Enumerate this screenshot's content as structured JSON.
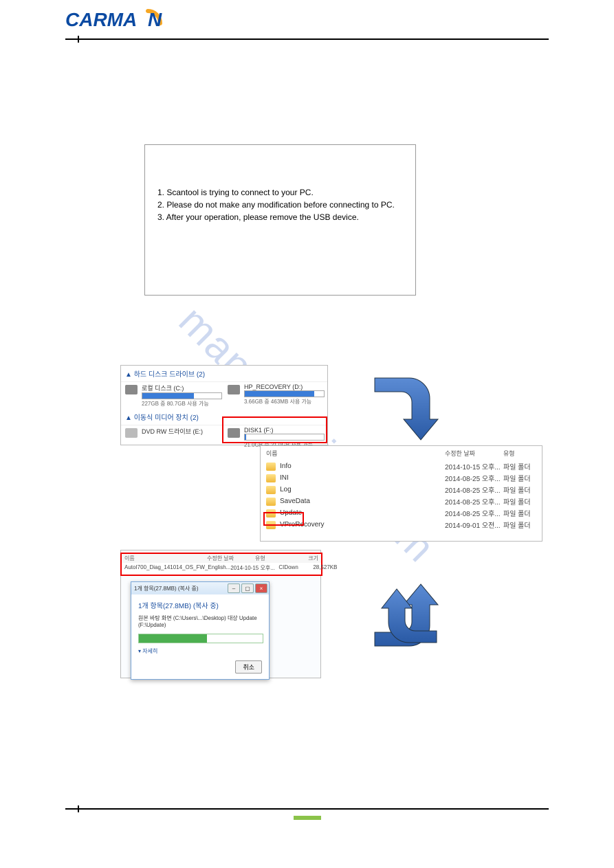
{
  "brand": {
    "name": "CARMAN"
  },
  "dialog1": {
    "line1": "1. Scantool is trying to connect to your PC.",
    "line2": "2. Please do not make any modification before connecting to PC.",
    "line3": "3. After your operation, please remove the USB device."
  },
  "explorer": {
    "section_hdd": "하드 디스크 드라이브 (2)",
    "drive_c": {
      "name": "로컬 디스크 (C:)",
      "sub": "227GB 중 80.7GB 사용 가능",
      "fill_pct": 65
    },
    "drive_d": {
      "name": "HP_RECOVERY (D:)",
      "sub": "3.66GB 중 463MB 사용 가능",
      "fill_pct": 88
    },
    "section_rem": "이동식 미디어 장치 (2)",
    "drive_e": {
      "name": "DVD RW 드라이브 (E:)"
    },
    "drive_f": {
      "name": "DISK1 (F:)",
      "sub": "21.0GB 중 21.0GB 사용 가능",
      "fill_pct": 2
    }
  },
  "folders": {
    "head_name": "이름",
    "head_date": "수정한 날짜",
    "head_type": "유형",
    "type_label": "파일 폴더",
    "items": [
      {
        "name": "Info",
        "date": "2014-10-15 오후..."
      },
      {
        "name": "INI",
        "date": "2014-08-25 오후..."
      },
      {
        "name": "Log",
        "date": "2014-08-25 오후..."
      },
      {
        "name": "SaveData",
        "date": "2014-08-25 오후..."
      },
      {
        "name": "Update",
        "date": "2014-08-25 오후..."
      },
      {
        "name": "VProRecovery",
        "date": "2014-09-01 오전..."
      }
    ]
  },
  "filelist": {
    "head_name": "이름",
    "head_date": "수정한 날짜",
    "head_type": "유형",
    "head_size": "크기",
    "file": {
      "name": "AutoI700_Diag_141014_OS_FW_English...",
      "date": "2014-10-15 오후...",
      "type": "CIDown",
      "size": "28,527KB"
    }
  },
  "copy": {
    "title": "1개 항목(27.8MB) (복사 중)",
    "heading": "1개 항목(27.8MB) (복사 중)",
    "line": "원본 바탕 화면 (C:\\Users\\...\\Desktop) 대상 Update (F:\\Update)",
    "more": "자세히",
    "cancel": "취소",
    "progress_pct": 55
  },
  "watermark": "manualshive.com"
}
